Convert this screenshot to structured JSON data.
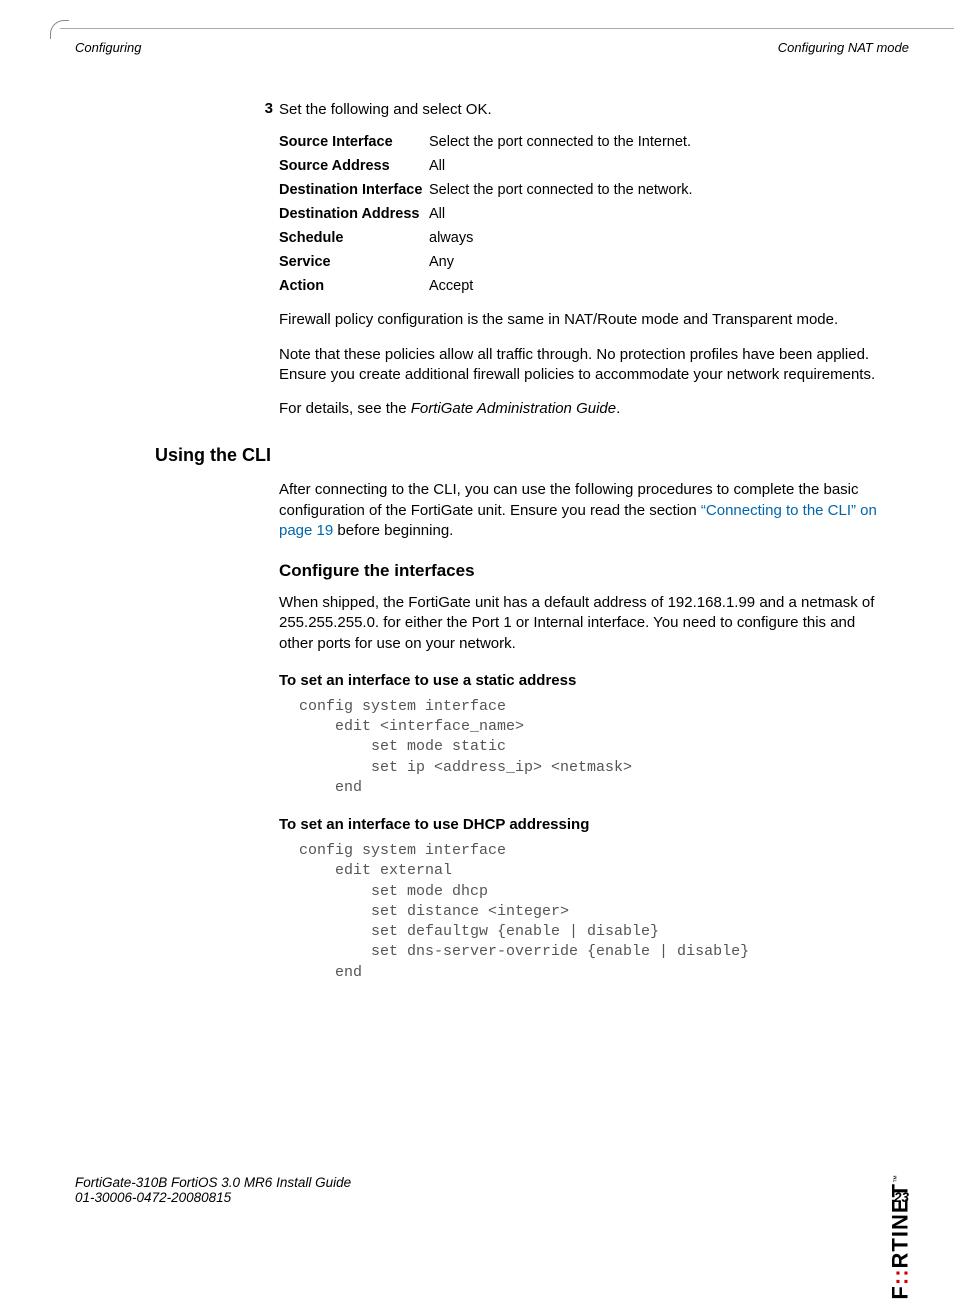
{
  "header": {
    "left": "Configuring",
    "right": "Configuring NAT mode"
  },
  "step": {
    "number": "3",
    "text": "Set the following and select OK."
  },
  "params": [
    {
      "label": "Source Interface",
      "value": "Select the port connected to the Internet."
    },
    {
      "label": "Source Address",
      "value": "All"
    },
    {
      "label": "Destination Interface",
      "value": "Select the port connected to the network."
    },
    {
      "label": "Destination Address",
      "value": "All"
    },
    {
      "label": "Schedule",
      "value": "always"
    },
    {
      "label": "Service",
      "value": "Any"
    },
    {
      "label": "Action",
      "value": "Accept"
    }
  ],
  "paragraphs": {
    "p1": "Firewall policy configuration is the same in NAT/Route mode and Transparent mode.",
    "p2": "Note that these policies allow all traffic through. No protection profiles have been applied. Ensure you create additional firewall policies to accommodate your network requirements.",
    "p3_pre": "For details, see the ",
    "p3_em": "FortiGate Administration Guide",
    "p3_post": "."
  },
  "h2": "Using the CLI",
  "cli_intro_pre": "After connecting to the CLI, you can use the following procedures to complete the basic configuration of the FortiGate unit. Ensure you read the section ",
  "cli_intro_link": "“Connecting to the CLI” on page 19",
  "cli_intro_post": " before beginning.",
  "h3": "Configure the interfaces",
  "cfg_intro": "When shipped, the FortiGate unit has a default address of 192.168.1.99 and a netmask of 255.255.255.0. for either the Port 1 or Internal interface. You need to configure this and other ports for use on your network.",
  "h4a": "To set an interface to use a static address",
  "code_a": "config system interface\n    edit <interface_name>\n        set mode static\n        set ip <address_ip> <netmask>\n    end",
  "h4b": "To set an interface to use DHCP addressing",
  "code_b": "config system interface\n    edit external\n        set mode dhcp\n        set distance <integer>\n        set defaultgw {enable | disable}\n        set dns-server-override {enable | disable}\n    end",
  "logo": {
    "pre": "F",
    "red": "::",
    "post": "RTINET",
    "tm": "™"
  },
  "footer": {
    "line1": "FortiGate-310B FortiOS 3.0 MR6 Install Guide",
    "line2": "01-30006-0472-20080815",
    "page": "23"
  }
}
